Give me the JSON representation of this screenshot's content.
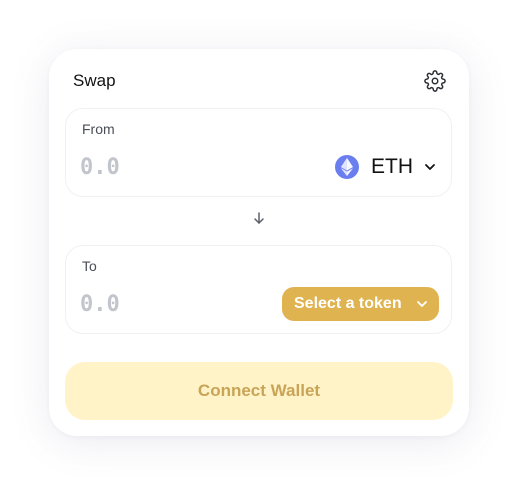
{
  "swap": {
    "title": "Swap",
    "settings_icon": "gear-icon"
  },
  "from": {
    "label": "From",
    "amount_placeholder": "0.0",
    "token_symbol": "ETH",
    "token_icon": "ethereum-icon"
  },
  "direction_icon": "arrow-down-icon",
  "to": {
    "label": "To",
    "amount_placeholder": "0.0",
    "select_label": "Select a token"
  },
  "connect_label": "Connect Wallet",
  "colors": {
    "accent": "#dfb350",
    "connect_bg": "#fff3c7",
    "connect_text": "#c9a457",
    "eth": "#6b7ef0",
    "placeholder": "#c3c5cc"
  }
}
